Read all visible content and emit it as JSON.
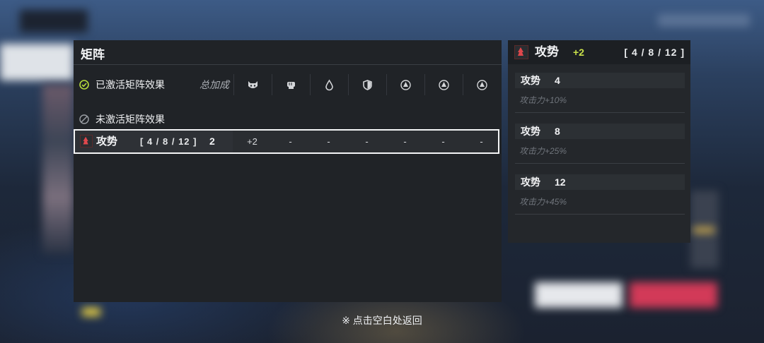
{
  "matrix_panel": {
    "title": "矩阵",
    "active_section_label": "已激活矩阵效果",
    "total_bonus_label": "总加成",
    "inactive_section_label": "未激活矩阵效果",
    "type_columns": [
      "cat-mask-icon",
      "fist-icon",
      "drop-icon",
      "shield-icon",
      "triangle-circle-icon",
      "triangle-circle-icon",
      "triangle-circle-icon"
    ],
    "effect_row": {
      "name": "攻势",
      "range": "[ 4 / 8 / 12 ]",
      "count": "2",
      "cells": [
        "+2",
        "-",
        "-",
        "-",
        "-",
        "-",
        "-"
      ]
    }
  },
  "detail_panel": {
    "name": "攻势",
    "bonus": "+2",
    "range": "[ 4 / 8 / 12 ]",
    "tiers": [
      {
        "name": "攻势",
        "threshold": "4",
        "description": "攻击力+10%"
      },
      {
        "name": "攻势",
        "threshold": "8",
        "description": "攻击力+25%"
      },
      {
        "name": "攻势",
        "threshold": "12",
        "description": "攻击力+45%"
      }
    ]
  },
  "footer": {
    "hint": "※ 点击空白处返回"
  },
  "colors": {
    "accent_green": "#c9e14a",
    "check_green": "#b7dc3c",
    "icon_red": "#e0474c"
  }
}
